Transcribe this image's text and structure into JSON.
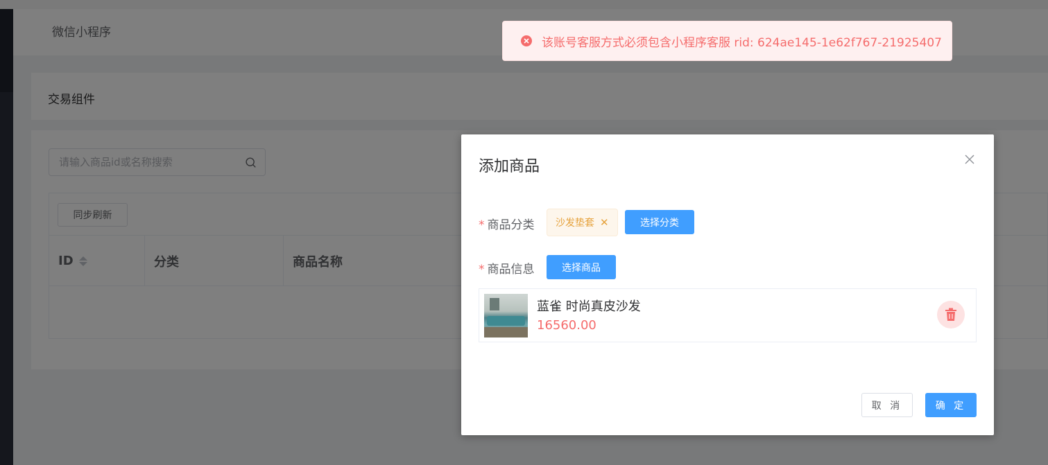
{
  "page": {
    "header_title": "微信小程序",
    "section_title": "交易组件",
    "search": {
      "placeholder": "请输入商品id或名称搜索",
      "value": ""
    },
    "sync_button": "同步刷新",
    "table": {
      "columns": [
        "ID",
        "分类",
        "商品名称"
      ]
    }
  },
  "modal": {
    "title": "添加商品",
    "category_label": "商品分类",
    "category_tag": "沙发垫套",
    "select_category_button": "选择分类",
    "product_label": "商品信息",
    "select_product_button": "选择商品",
    "product": {
      "name": "蓝雀 时尚真皮沙发",
      "price": "16560.00"
    },
    "cancel_button": "取 消",
    "confirm_button": "确 定"
  },
  "toast": {
    "type": "error",
    "message": "该账号客服方式必须包含小程序客服 rid: 624ae145-1e62f767-21925407"
  },
  "colors": {
    "primary": "#409eff",
    "danger": "#f56c6c",
    "warning": "#e6a23c"
  }
}
